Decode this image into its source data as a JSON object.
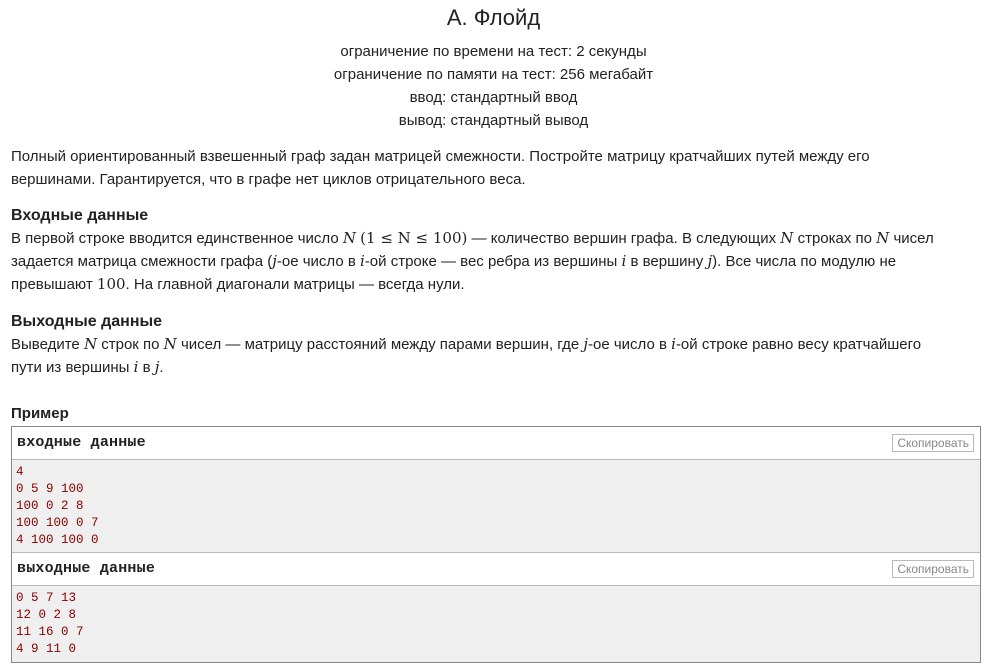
{
  "header": {
    "title": "A. Флойд",
    "time_limit": "ограничение по времени на тест: 2 секунды",
    "memory_limit": "ограничение по памяти на тест: 256 мегабайт",
    "input_file": "ввод: стандартный ввод",
    "output_file": "вывод: стандартный вывод"
  },
  "legend": {
    "line1": "Полный ориентированный взвешенный граф задан матрицей смежности. Постройте матрицу кратчайших путей между его",
    "line2": "вершинами. Гарантируется, что в графе нет циклов отрицательного веса."
  },
  "input_spec": {
    "title": "Входные данные",
    "p1": "В первой строке вводится единственное число ",
    "var_n": "N",
    "constraint": "(1 ≤ N ≤ 100)",
    "p2": " — количество вершин графа. В следующих ",
    "p3": " строках по ",
    "p4": " чисел",
    "p5": "задается матрица смежности графа (",
    "var_j": "j",
    "p6": "-ое число в ",
    "var_i": "i",
    "p7": "-ой строке — вес ребра из вершины ",
    "p8": " в вершину ",
    "p9": "). Все числа по модулю не",
    "p10": "превышают ",
    "num100": "100",
    "p11": ". На главной диагонали матрицы — всегда нули."
  },
  "output_spec": {
    "title": "Выходные данные",
    "p1": "Выведите ",
    "var_n": "N",
    "p2": " строк по ",
    "p3": " чисел — матрицу расстояний между парами вершин, где ",
    "var_j": "j",
    "p4": "-ое число в ",
    "var_i": "i",
    "p5": "-ой строке равно весу кратчайшего",
    "p6": "пути из вершины ",
    "p7": " в ",
    "p8": "."
  },
  "sample": {
    "title": "Пример",
    "copy_label": "Скопировать",
    "input": {
      "label": "входные данные",
      "lines": [
        "4",
        "0 5 9 100",
        "100 0 2 8",
        "100 100 0 7",
        "4 100 100 0"
      ]
    },
    "output": {
      "label": "выходные данные",
      "lines": [
        "0 5 7 13",
        "12 0 2 8",
        "11 16 0 7",
        "4 9 11 0"
      ]
    }
  },
  "colors": {
    "text": "#222222",
    "sample_text": "#880000",
    "sample_bg": "#efefef",
    "border": "#888888",
    "copy_text": "#888888"
  }
}
